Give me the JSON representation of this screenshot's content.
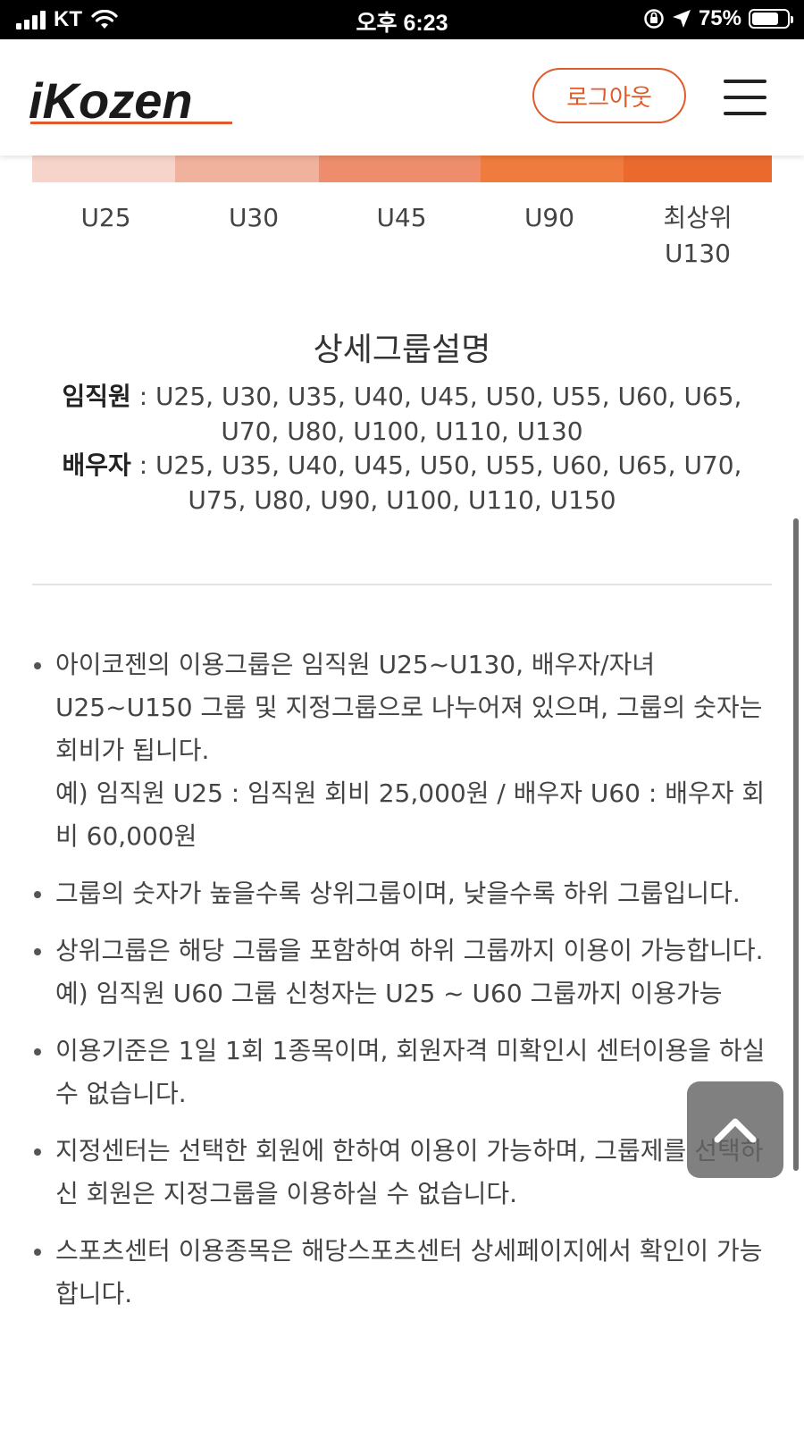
{
  "status_bar": {
    "carrier": "KT",
    "time": "오후 6:23",
    "battery": "75%",
    "battery_level": 0.75
  },
  "header": {
    "logo_text": "iKozen",
    "logout_label": "로그아웃",
    "menu_icon": "hamburger-icon",
    "brand_color": "#e05a2a"
  },
  "levels": {
    "colors": [
      "#f6d4c9",
      "#f0b19d",
      "#ed8d6b",
      "#ef7b3e",
      "#ea6a2e"
    ],
    "labels": [
      "U25",
      "U30",
      "U45",
      "U90",
      "최상위\nU130"
    ]
  },
  "detail": {
    "title": "상세그룹설명",
    "employee_label": "임직원",
    "employee_groups": "U25, U30, U35, U40, U45, U50, U55, U60, U65, U70, U80, U100, U110, U130",
    "spouse_label": "배우자",
    "spouse_groups": "U25, U35, U40, U45, U50, U55, U60, U65, U70, U75, U80, U90, U100, U110, U150"
  },
  "notes": [
    "아이코젠의 이용그룹은 임직원 U25~U130, 배우자/자녀 U25~U150 그룹 및 지정그룹으로 나누어져 있으며, 그룹의 숫자는 회비가 됩니다.\n예) 임직원 U25 : 임직원 회비 25,000원 / 배우자 U60 : 배우자 회비 60,000원",
    "그룹의 숫자가 높을수록 상위그룹이며, 낮을수록 하위 그룹입니다.",
    "상위그룹은 해당 그룹을 포함하여 하위 그룹까지 이용이 가능합니다.\n예) 임직원 U60 그룹 신청자는 U25 ~ U60 그룹까지 이용가능",
    "이용기준은 1일 1회 1종목이며, 회원자격 미확인시 센터이용을 하실 수 없습니다.",
    "지정센터는 선택한 회원에 한하여 이용이 가능하며, 그룹제를 선택하신 회원은 지정그룹을 이용하실 수 없습니다.",
    "스포츠센터 이용종목은 해당스포츠센터 상세페이지에서 확인이 가능 합니다."
  ]
}
